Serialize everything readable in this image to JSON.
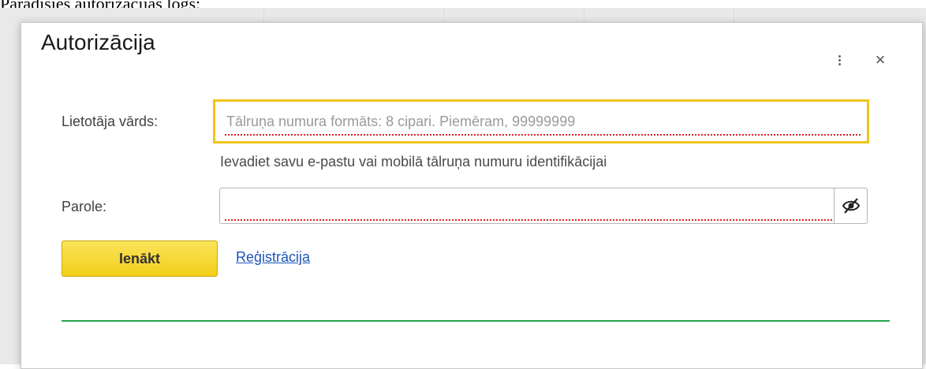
{
  "caption": "Parādīsies autorizācijas logs:",
  "dialog": {
    "title": "Autorizācija",
    "menu_icon": "more-vertical-icon",
    "close_glyph": "×"
  },
  "form": {
    "username": {
      "label": "Lietotāja vārds:",
      "value": "",
      "placeholder": "Tālruņa numura formāts: 8 cipari. Piemēram, 99999999",
      "hint": "Ievadiet savu e-pastu vai mobilā tālruņa numuru identifikācijai",
      "focus_color": "#f0c419"
    },
    "password": {
      "label": "Parole:",
      "value": "",
      "toggle_icon": "eye-hidden-icon"
    },
    "login_button_label": "Ienākt",
    "register_link_label": "Reģistrācija"
  },
  "colors": {
    "button": "#f2cf1a",
    "link": "#1a55b8",
    "progress": "#27a54a",
    "spellcheck": "#e02020"
  }
}
